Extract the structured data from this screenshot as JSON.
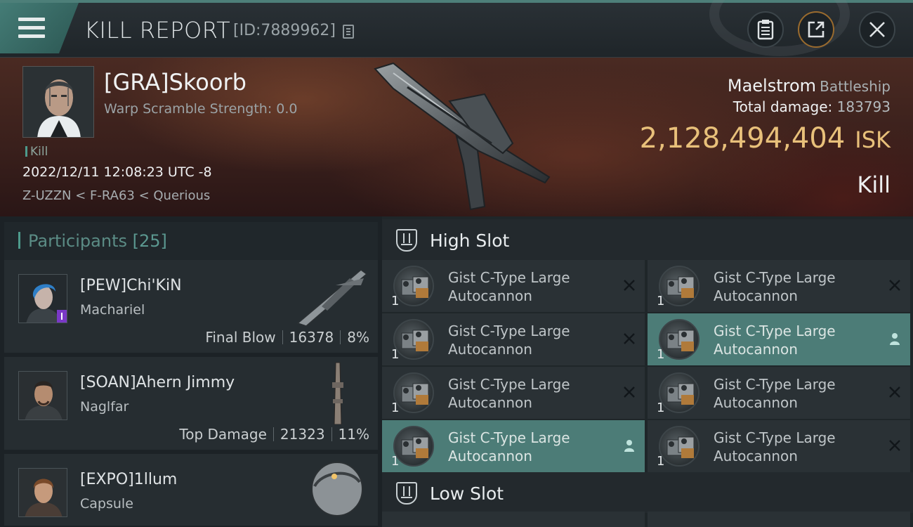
{
  "header": {
    "title": "KILL REPORT",
    "report_id": "[ID:7889962]",
    "buttons": [
      {
        "name": "clipboard-icon"
      },
      {
        "name": "share-icon"
      },
      {
        "name": "close-icon"
      }
    ]
  },
  "victim": {
    "name": "[GRA]Skoorb",
    "scramble": "Warp Scramble Strength: 0.0",
    "kill_tag": "Kill",
    "datetime": "2022/12/11 12:08:23 UTC -8",
    "location": "Z-UZZN < F-RA63 < Querious",
    "ship_name": "Maelstrom",
    "ship_class": "Battleship",
    "damage_label": "Total damage:",
    "damage_value": "183793",
    "isk_value": "2,128,494,404",
    "isk_unit": "ISK",
    "result": "Kill"
  },
  "participants": {
    "label": "Participants",
    "count": "[25]",
    "items": [
      {
        "name": "[PEW]Chi'KiN",
        "ship": "Machariel",
        "role": "Final Blow",
        "damage": "16378",
        "percent": "8%"
      },
      {
        "name": "[SOAN]Ahern Jimmy",
        "ship": "Naglfar",
        "role": "Top Damage",
        "damage": "21323",
        "percent": "11%"
      },
      {
        "name": "[EXPO]1llum",
        "ship": "Capsule",
        "role": "",
        "damage": "",
        "percent": ""
      }
    ]
  },
  "high_slot": {
    "title": "High Slot",
    "modules": [
      {
        "name": "Gist C-Type Large Autocannon",
        "qty": "1",
        "status": "destroyed"
      },
      {
        "name": "Gist C-Type Large Autocannon",
        "qty": "1",
        "status": "destroyed"
      },
      {
        "name": "Gist C-Type Large Autocannon",
        "qty": "1",
        "status": "destroyed"
      },
      {
        "name": "Gist C-Type Large Autocannon",
        "qty": "1",
        "status": "dropped"
      },
      {
        "name": "Gist C-Type Large Autocannon",
        "qty": "1",
        "status": "destroyed"
      },
      {
        "name": "Gist C-Type Large Autocannon",
        "qty": "1",
        "status": "destroyed"
      },
      {
        "name": "Gist C-Type Large Autocannon",
        "qty": "1",
        "status": "dropped"
      },
      {
        "name": "Gist C-Type Large Autocannon",
        "qty": "1",
        "status": "destroyed"
      }
    ]
  },
  "low_slot": {
    "title": "Low Slot"
  },
  "colors": {
    "accent": "#4c7c77",
    "isk": "#e8c07a",
    "panel": "#2a3135"
  }
}
